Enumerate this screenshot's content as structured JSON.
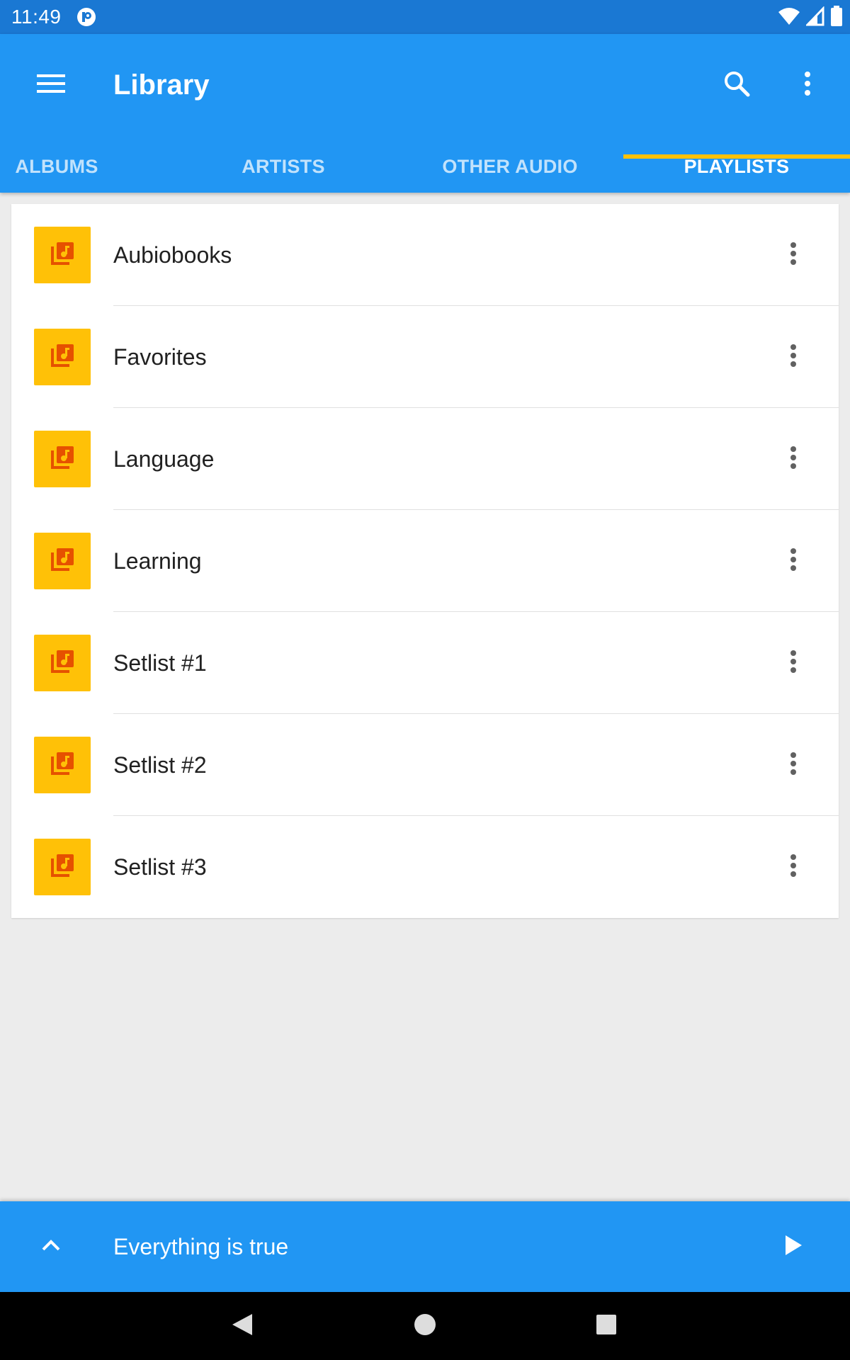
{
  "status_bar": {
    "time": "11:49",
    "icons": [
      "app-notification-icon",
      "wifi-icon",
      "cell-signal-icon",
      "battery-icon"
    ]
  },
  "app_bar": {
    "title": "Library",
    "background_color": "#2196f3",
    "icons": [
      "hamburger-menu-icon",
      "search-icon",
      "more-vert-icon"
    ]
  },
  "tabs": [
    {
      "label": "ALBUMS",
      "active": false
    },
    {
      "label": "ARTISTS",
      "active": false
    },
    {
      "label": "OTHER AUDIO",
      "active": false
    },
    {
      "label": "PLAYLISTS",
      "active": true
    }
  ],
  "tab_indicator_color": "#ffc107",
  "playlists": [
    {
      "name": "Aubiobooks"
    },
    {
      "name": "Favorites"
    },
    {
      "name": "Language"
    },
    {
      "name": "Learning"
    },
    {
      "name": "Setlist #1"
    },
    {
      "name": "Setlist #2"
    },
    {
      "name": "Setlist #3"
    }
  ],
  "playlist_icon": "playlist-music-icon",
  "playlist_thumb_color": "#ffc107",
  "now_playing": {
    "title": "Everything is true",
    "icons": [
      "chevron-up-icon",
      "play-icon"
    ]
  },
  "nav_bar": {
    "icons": [
      "back-icon",
      "home-icon",
      "recents-icon"
    ]
  }
}
